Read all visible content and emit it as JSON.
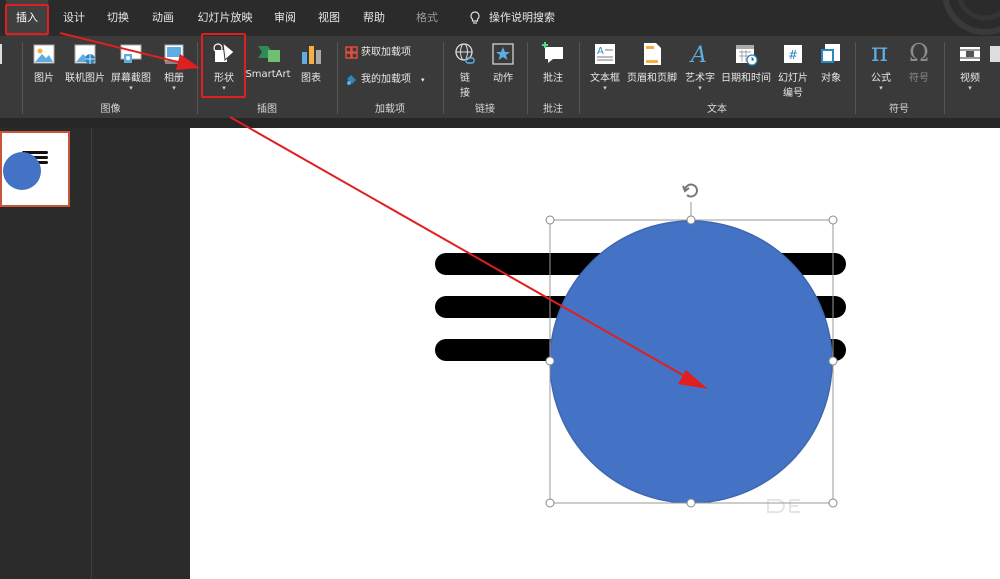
{
  "tabs": [
    {
      "label": "插入",
      "active": true
    },
    {
      "label": "设计"
    },
    {
      "label": "切换"
    },
    {
      "label": "动画"
    },
    {
      "label": "幻灯片放映"
    },
    {
      "label": "审阅"
    },
    {
      "label": "视图"
    },
    {
      "label": "帮助"
    },
    {
      "label": "格式",
      "dim": true
    }
  ],
  "search": {
    "label": "操作说明搜索",
    "icon": "lightbulb-icon"
  },
  "ribbon": {
    "images": {
      "group_label": "图像",
      "picture": "图片",
      "online_picture": "联机图片",
      "screenshot": "屏幕截图",
      "album": "相册"
    },
    "illustrations": {
      "group_label": "插图",
      "shapes": "形状",
      "smartart": "SmartArt",
      "chart": "图表"
    },
    "addins": {
      "group_label": "加载项",
      "get_addins": "获取加载项",
      "my_addins": "我的加载项"
    },
    "links": {
      "group_label": "链接",
      "link_top": "链",
      "link_bottom": "接",
      "action": "动作"
    },
    "comments": {
      "group_label": "批注",
      "comment": "批注"
    },
    "text": {
      "group_label": "文本",
      "textbox": "文本框",
      "header_footer": "页眉和页脚",
      "wordart": "艺术字",
      "datetime": "日期和时间",
      "slide_number_top": "幻灯片",
      "slide_number_bottom": "编号",
      "object": "对象"
    },
    "symbols": {
      "group_label": "符号",
      "equation": "公式",
      "symbol": "符号"
    },
    "media": {
      "video": "视频"
    }
  },
  "colors": {
    "accent_red": "#e02020",
    "circle_fill": "#4472c4",
    "circle_stroke": "#3f67b0",
    "ribbon_bg": "#3a3a3a"
  }
}
